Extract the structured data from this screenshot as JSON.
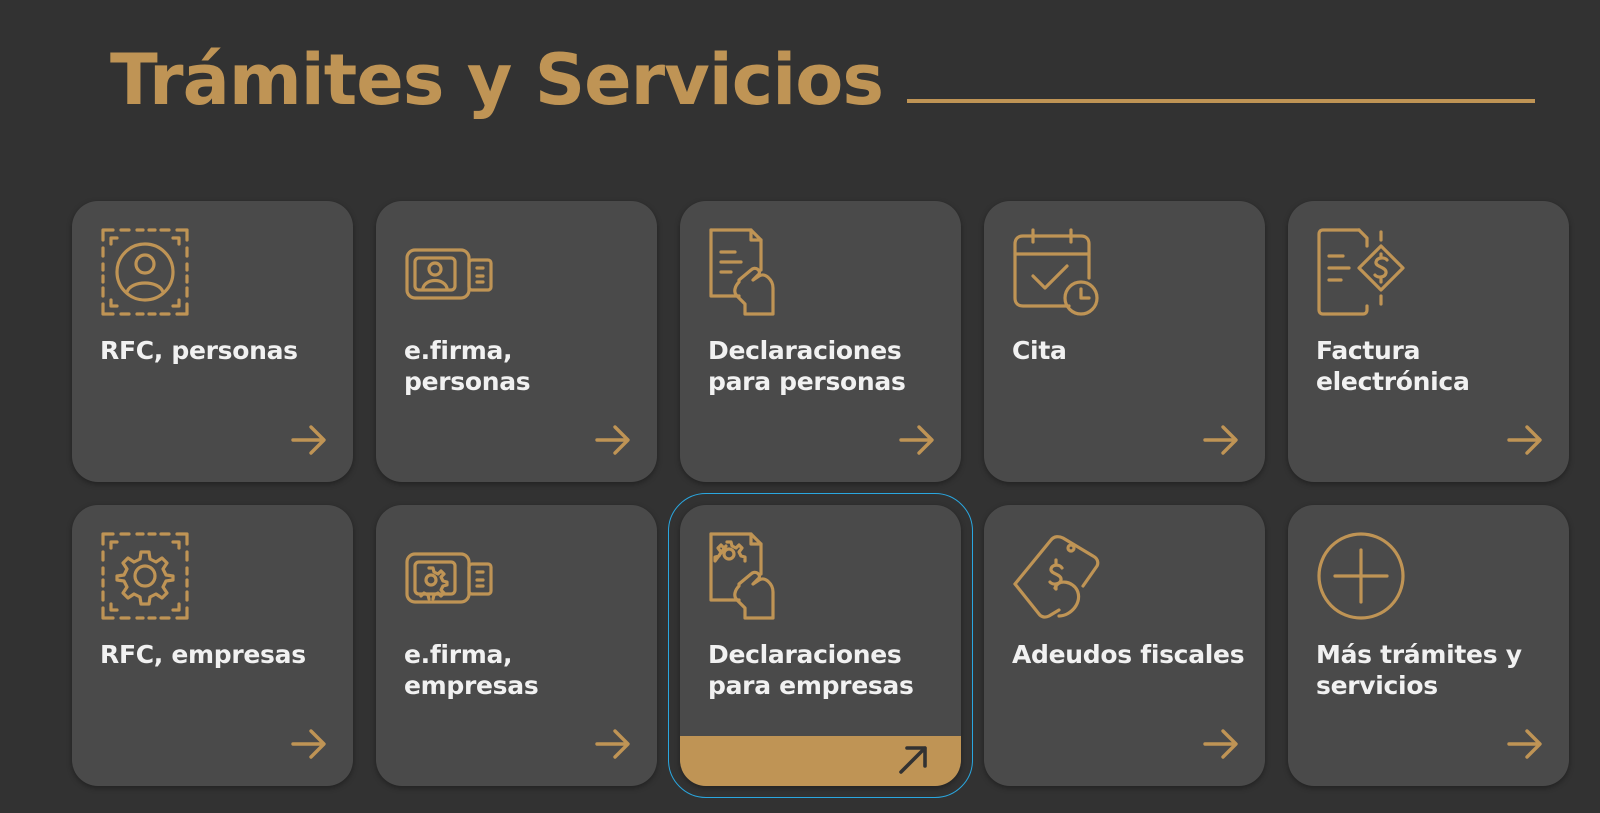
{
  "header": {
    "title": "Trámites y Servicios"
  },
  "colors": {
    "accent": "#bf9455",
    "background": "#323232",
    "card": "#4a4a4a",
    "text": "#f1f1f1",
    "focus_outline": "#2aa7e0"
  },
  "cards": [
    {
      "label": "RFC, personas",
      "icon": "face-scan-icon"
    },
    {
      "label": "e.firma, personas",
      "icon": "usb-id-icon"
    },
    {
      "label": "Declaraciones para personas",
      "icon": "document-hand-icon"
    },
    {
      "label": "Cita",
      "icon": "calendar-clock-icon"
    },
    {
      "label": "Factura electrónica",
      "icon": "invoice-dollar-icon"
    },
    {
      "label": "RFC, empresas",
      "icon": "gear-scan-icon"
    },
    {
      "label": "e.firma, empresas",
      "icon": "usb-gear-icon"
    },
    {
      "label": "Declaraciones para empresas",
      "icon": "document-gear-hand-icon",
      "active": true
    },
    {
      "label": "Adeudos fiscales",
      "icon": "money-tag-hand-icon"
    },
    {
      "label": "Más trámites y servicios",
      "icon": "plus-circle-icon"
    }
  ]
}
